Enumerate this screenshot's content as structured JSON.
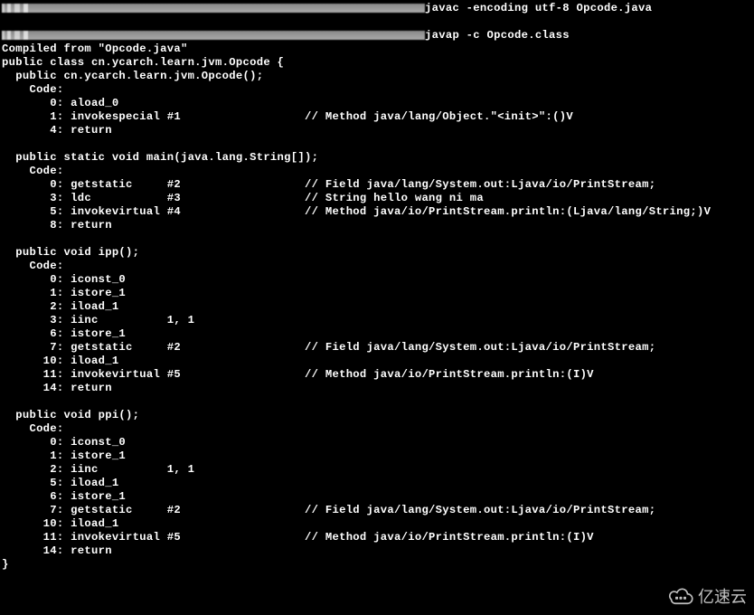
{
  "cmd1": "javac -encoding utf-8 Opcode.java",
  "cmd2": "javap -c Opcode.class",
  "line_compiled_from": "Compiled from \"Opcode.java\"",
  "line_class_decl": "public class cn.ycarch.learn.jvm.Opcode {",
  "ctor_sig": "  public cn.ycarch.learn.jvm.Opcode();",
  "code_label": "    Code:",
  "ctor_0": "       0: aload_0",
  "ctor_1a": "       1: invokespecial #1",
  "ctor_1c": "// Method java/lang/Object.\"<init>\":()V",
  "ctor_4": "       4: return",
  "main_sig": "  public static void main(java.lang.String[]);",
  "main_0a": "       0: getstatic     #2",
  "main_0c": "// Field java/lang/System.out:Ljava/io/PrintStream;",
  "main_3a": "       3: ldc           #3",
  "main_3c": "// String hello wang ni ma",
  "main_5a": "       5: invokevirtual #4",
  "main_5c": "// Method java/io/PrintStream.println:(Ljava/lang/String;)V",
  "main_8": "       8: return",
  "ipp_sig": "  public void ipp();",
  "ipp_0": "       0: iconst_0",
  "ipp_1": "       1: istore_1",
  "ipp_2": "       2: iload_1",
  "ipp_3": "       3: iinc          1, 1",
  "ipp_6": "       6: istore_1",
  "ipp_7a": "       7: getstatic     #2",
  "ipp_7c": "// Field java/lang/System.out:Ljava/io/PrintStream;",
  "ipp_10": "      10: iload_1",
  "ipp_11a": "      11: invokevirtual #5",
  "ipp_11c": "// Method java/io/PrintStream.println:(I)V",
  "ipp_14": "      14: return",
  "ppi_sig": "  public void ppi();",
  "ppi_0": "       0: iconst_0",
  "ppi_1": "       1: istore_1",
  "ppi_2": "       2: iinc          1, 1",
  "ppi_5": "       5: iload_1",
  "ppi_6": "       6: istore_1",
  "ppi_7a": "       7: getstatic     #2",
  "ppi_7c": "// Field java/lang/System.out:Ljava/io/PrintStream;",
  "ppi_10": "      10: iload_1",
  "ppi_11a": "      11: invokevirtual #5",
  "ppi_11c": "// Method java/io/PrintStream.println:(I)V",
  "ppi_14": "      14: return",
  "close_brace": "}",
  "pad": "                  ",
  "watermark_text": "亿速云"
}
